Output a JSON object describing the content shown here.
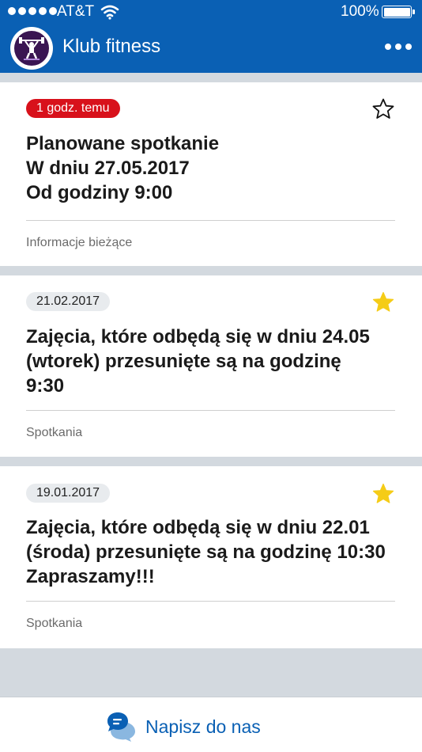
{
  "status_bar": {
    "carrier": "AT&T",
    "battery": "100%",
    "signal_bars": 5
  },
  "header": {
    "title": "Klub fitness",
    "logo_icon": "weightlifter-logo-icon",
    "menu_icon": "more-dots-icon"
  },
  "posts": [
    {
      "badge": "1 godz. temu",
      "starred": false,
      "lines": [
        "Planowane spotkanie",
        "W dniu 27.05.2017",
        "Od godziny 9:00"
      ],
      "category": "Informacje bieżące"
    },
    {
      "badge": "21.02.2017",
      "starred": true,
      "lines": [
        "Zajęcia, które odbędą się w dniu 24.05",
        "(wtorek) przesunięte są na godzinę",
        "9:30"
      ],
      "category": "Spotkania"
    },
    {
      "badge": "19.01.2017",
      "starred": true,
      "lines": [
        "Zajęcia, które odbędą się w dniu 22.01",
        "(środa) przesunięte są na godzinę 10:30",
        "Zapraszamy!!!"
      ],
      "category": "Spotkania"
    }
  ],
  "footer": {
    "contact_label": "Napisz do nas",
    "contact_icon": "chat-bubbles-icon"
  },
  "colors": {
    "brand_blue": "#0a60b4",
    "badge_red": "#d8111b",
    "star_gold": "#f5cc17",
    "separator_gray": "#d3d9df"
  }
}
